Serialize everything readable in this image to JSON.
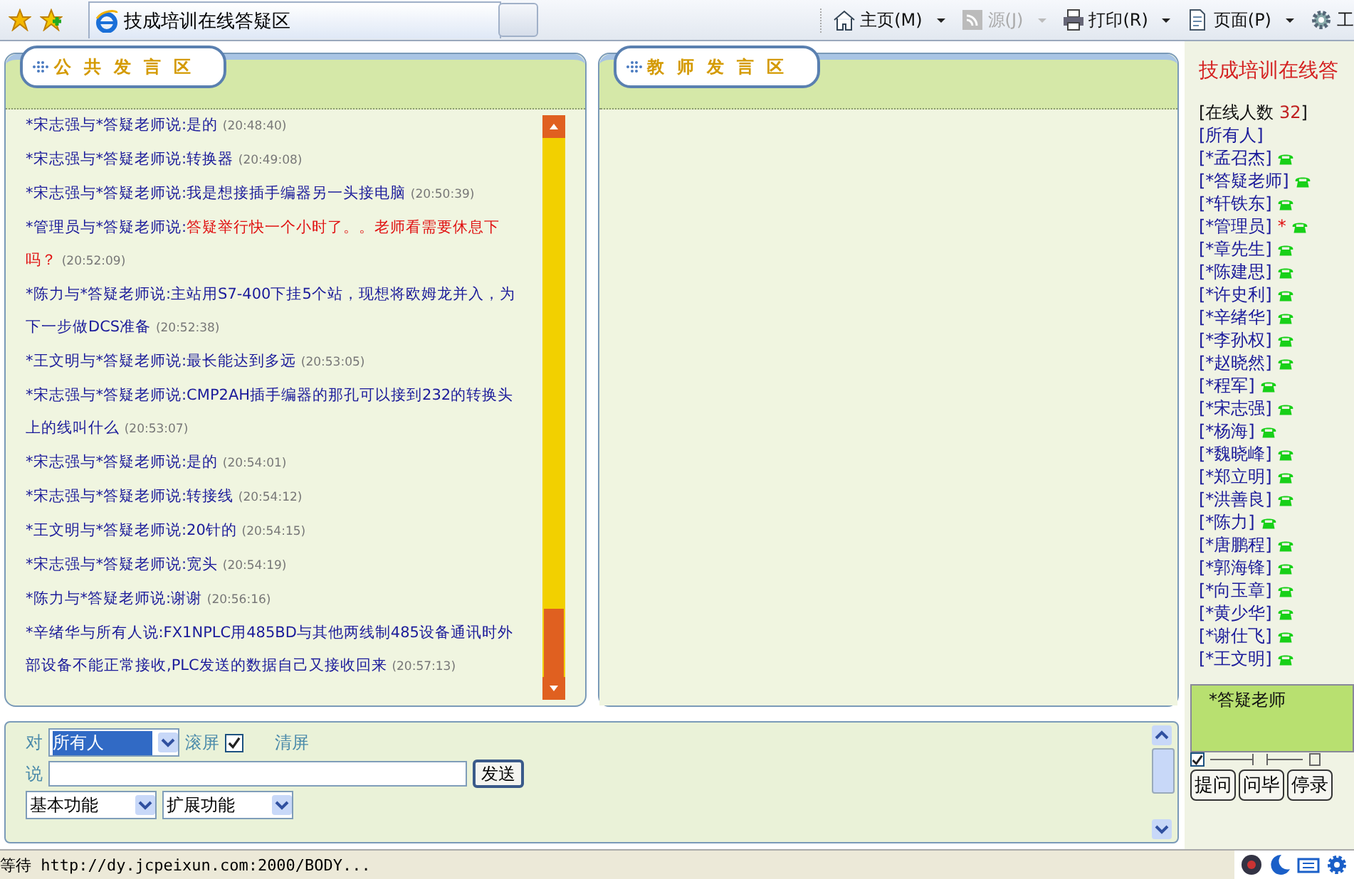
{
  "browser": {
    "tab_title": "技成培训在线答疑区",
    "commands": [
      {
        "label": "主页(M)",
        "disabled": false,
        "kind": "home"
      },
      {
        "label": "源(J)",
        "disabled": true,
        "kind": "feed"
      },
      {
        "label": "打印(R)",
        "disabled": false,
        "kind": "print"
      },
      {
        "label": "页面(P)",
        "disabled": false,
        "kind": "page"
      },
      {
        "label": "工",
        "disabled": false,
        "kind": "tools"
      }
    ]
  },
  "public_panel": {
    "title": "公共发言区",
    "messages": [
      {
        "from": "*宋志强与*答疑老师说:",
        "text": "是的",
        "time": "(20:48:40)",
        "highlight": false
      },
      {
        "from": "*宋志强与*答疑老师说:",
        "text": "转换器",
        "time": "(20:49:08)",
        "highlight": false
      },
      {
        "from": "*宋志强与*答疑老师说:",
        "text": "我是想接插手编器另一头接电脑",
        "time": "(20:50:39)",
        "highlight": false
      },
      {
        "from": "*管理员与*答疑老师说:",
        "text": "答疑举行快一个小时了。。老师看需要休息下吗？",
        "time": "(20:52:09)",
        "highlight": true
      },
      {
        "from": "*陈力与*答疑老师说:",
        "text": "主站用S7-400下挂5个站，现想将欧姆龙并入，为下一步做DCS准备",
        "time": "(20:52:38)",
        "highlight": false
      },
      {
        "from": "*王文明与*答疑老师说:",
        "text": "最长能达到多远",
        "time": "(20:53:05)",
        "highlight": false
      },
      {
        "from": "*宋志强与*答疑老师说:",
        "text": "CMP2AH插手编器的那孔可以接到232的转换头上的线叫什么",
        "time": "(20:53:07)",
        "highlight": false
      },
      {
        "from": "*宋志强与*答疑老师说:",
        "text": "是的",
        "time": "(20:54:01)",
        "highlight": false
      },
      {
        "from": "*宋志强与*答疑老师说:",
        "text": "转接线",
        "time": "(20:54:12)",
        "highlight": false
      },
      {
        "from": "*王文明与*答疑老师说:",
        "text": "20针的",
        "time": "(20:54:15)",
        "highlight": false
      },
      {
        "from": "*宋志强与*答疑老师说:",
        "text": "宽头",
        "time": "(20:54:19)",
        "highlight": false
      },
      {
        "from": "*陈力与*答疑老师说:",
        "text": "谢谢",
        "time": "(20:56:16)",
        "highlight": false
      },
      {
        "from": "*辛绪华与所有人说:",
        "text": "FX1NPLC用485BD与其他两线制485设备通讯时外部设备不能正常接收,PLC发送的数据自己又接收回来",
        "time": "(20:57:13)",
        "highlight": false
      }
    ]
  },
  "teacher_panel": {
    "title": "教师发言区"
  },
  "input_bar": {
    "to_label": "对",
    "recipient": "所有人",
    "scroll_label": "滚屏",
    "scroll_checked": true,
    "clear_label": "清屏",
    "say_label": "说",
    "send_button": "发送",
    "menus": [
      "基本功能",
      "扩展功能"
    ]
  },
  "sidebar": {
    "title": "技成培训在线答",
    "online_label": "[在线人数",
    "online_count": "32",
    "online_close": "]",
    "users": [
      {
        "name": "[所有人]",
        "phone": false
      },
      {
        "name": "[*孟召杰]",
        "phone": true
      },
      {
        "name": "[*答疑老师]",
        "phone": true
      },
      {
        "name": "[*轩铁东]",
        "phone": true
      },
      {
        "name": "[*管理员]",
        "phone": true,
        "mark": "*"
      },
      {
        "name": "[*章先生]",
        "phone": true
      },
      {
        "name": "[*陈建思]",
        "phone": true
      },
      {
        "name": "[*许史利]",
        "phone": true
      },
      {
        "name": "[*辛绪华]",
        "phone": true
      },
      {
        "name": "[*李孙权]",
        "phone": true
      },
      {
        "name": "[*赵晓然]",
        "phone": true
      },
      {
        "name": "[*程军]",
        "phone": true
      },
      {
        "name": "[*宋志强]",
        "phone": true
      },
      {
        "name": "[*杨海]",
        "phone": true
      },
      {
        "name": "[*魏晓峰]",
        "phone": true
      },
      {
        "name": "[*郑立明]",
        "phone": true
      },
      {
        "name": "[*洪善良]",
        "phone": true
      },
      {
        "name": "[*陈力]",
        "phone": true
      },
      {
        "name": "[*唐鹏程]",
        "phone": true
      },
      {
        "name": "[*郭海锋]",
        "phone": true
      },
      {
        "name": "[*向玉章]",
        "phone": true
      },
      {
        "name": "[*黄少华]",
        "phone": true
      },
      {
        "name": "[*谢仕飞]",
        "phone": true
      },
      {
        "name": "[*王文明]",
        "phone": true
      }
    ],
    "target_box": "*答疑老师",
    "target_checked": true,
    "buttons": [
      "提问",
      "问毕",
      "停录"
    ]
  },
  "status_bar": {
    "text": "等待 http://dy.jcpeixun.com:2000/BODY..."
  }
}
